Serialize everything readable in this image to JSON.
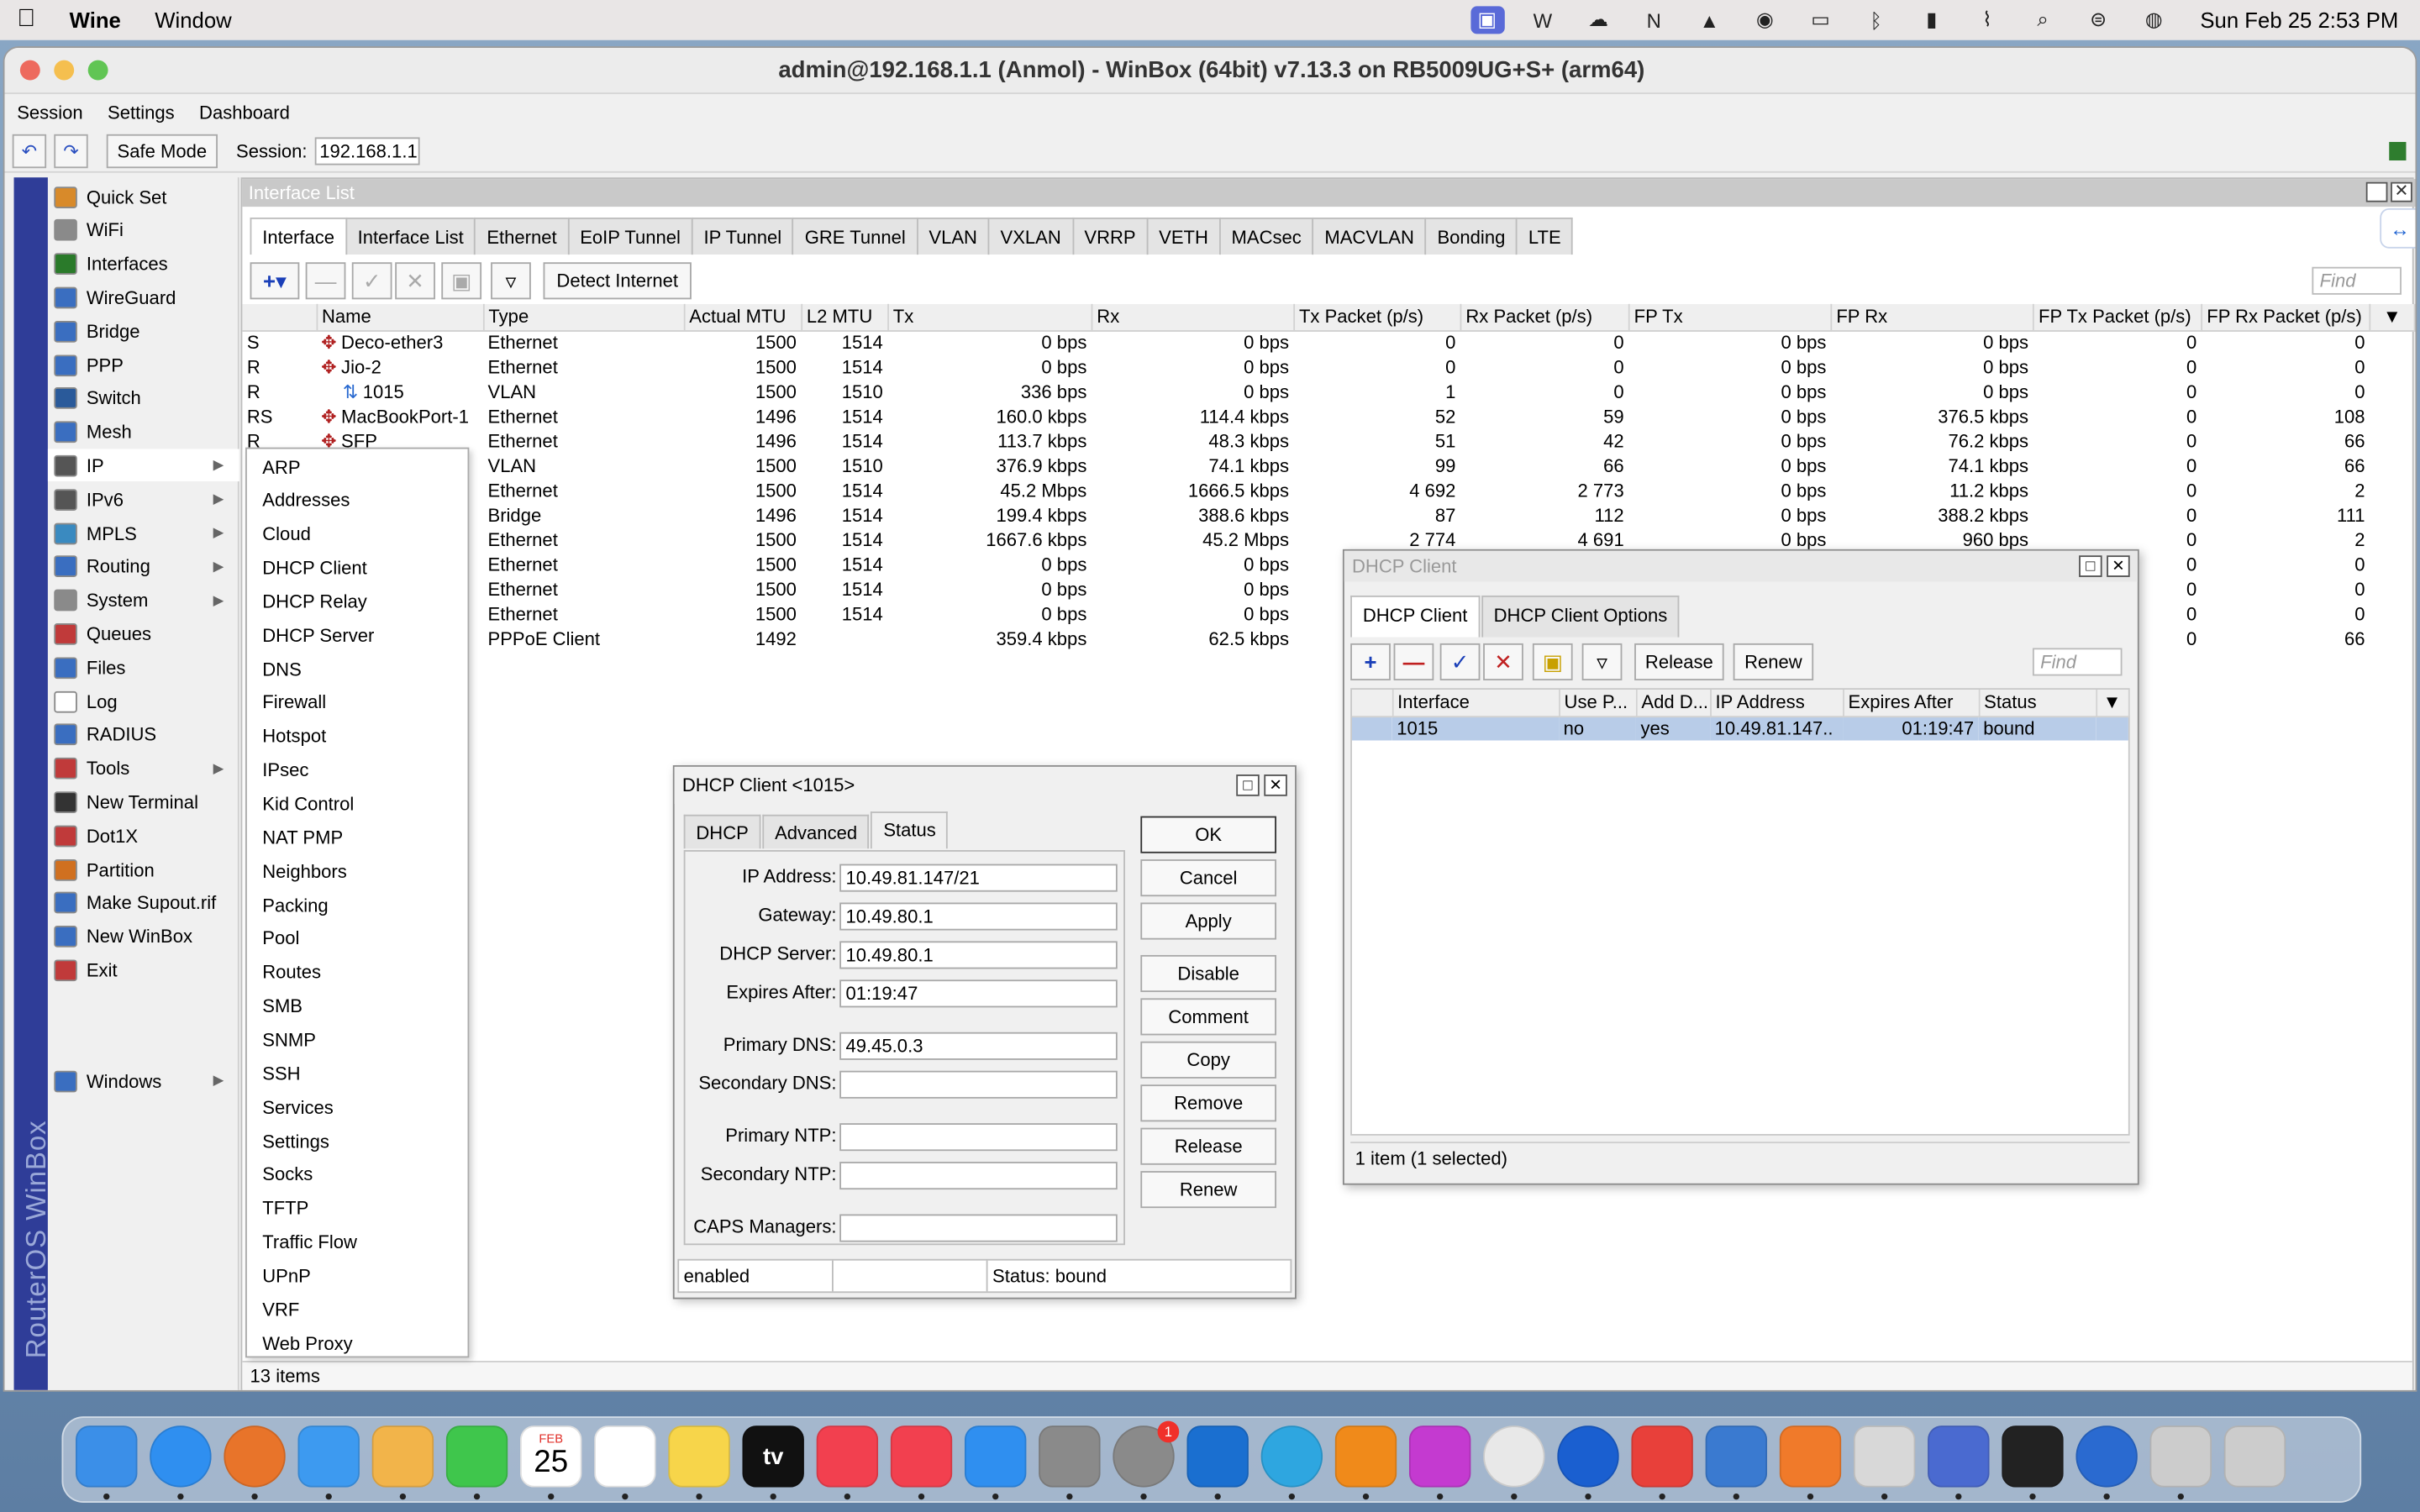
{
  "menubar": {
    "app_name": "Wine",
    "items": [
      "Window"
    ],
    "datetime": "Sun Feb 25  2:53 PM",
    "icons": [
      "screen-share-icon",
      "wps-icon",
      "cloud-icon",
      "n-icon",
      "vlc-icon",
      "notification-icon",
      "display-icon",
      "bluetooth-off-icon",
      "battery-icon",
      "wifi-off-icon",
      "search-icon",
      "control-center-icon",
      "siri-icon"
    ]
  },
  "window": {
    "title": "admin@192.168.1.1 (Anmol) - WinBox (64bit) v7.13.3 on RB5009UG+S+ (arm64)",
    "menu": [
      "Session",
      "Settings",
      "Dashboard"
    ],
    "safe_mode": "Safe Mode",
    "session_label": "Session:",
    "session_value": "192.168.1.1",
    "side_brand": "RouterOS WinBox"
  },
  "sidebar": [
    {
      "label": "Quick Set",
      "icon": "wand-icon",
      "color": "#d88a2a"
    },
    {
      "label": "WiFi",
      "icon": "wifi-icon",
      "color": "#8a8a8a"
    },
    {
      "label": "Interfaces",
      "icon": "interfaces-icon",
      "color": "#2a7a2a"
    },
    {
      "label": "WireGuard",
      "icon": "wireguard-icon",
      "color": "#3a6ec0"
    },
    {
      "label": "Bridge",
      "icon": "bridge-icon",
      "color": "#3a6ec0"
    },
    {
      "label": "PPP",
      "icon": "ppp-icon",
      "color": "#3a6ec0"
    },
    {
      "label": "Switch",
      "icon": "switch-icon",
      "color": "#2a5a9a"
    },
    {
      "label": "Mesh",
      "icon": "mesh-icon",
      "color": "#3a6ec0"
    },
    {
      "label": "IP",
      "icon": "ip-icon",
      "color": "#555555",
      "arrow": true
    },
    {
      "label": "IPv6",
      "icon": "ipv6-icon",
      "color": "#555555",
      "arrow": true
    },
    {
      "label": "MPLS",
      "icon": "mpls-icon",
      "color": "#3a8ac0",
      "arrow": true
    },
    {
      "label": "Routing",
      "icon": "routing-icon",
      "color": "#3a6ec0",
      "arrow": true
    },
    {
      "label": "System",
      "icon": "system-gear-icon",
      "color": "#8a8a8a",
      "arrow": true
    },
    {
      "label": "Queues",
      "icon": "queues-icon",
      "color": "#c03a3a"
    },
    {
      "label": "Files",
      "icon": "files-icon",
      "color": "#3a6ec0"
    },
    {
      "label": "Log",
      "icon": "log-icon",
      "color": "#ffffff"
    },
    {
      "label": "RADIUS",
      "icon": "radius-icon",
      "color": "#3a6ec0"
    },
    {
      "label": "Tools",
      "icon": "tools-icon",
      "color": "#c03a3a",
      "arrow": true
    },
    {
      "label": "New Terminal",
      "icon": "terminal-icon",
      "color": "#333333"
    },
    {
      "label": "Dot1X",
      "icon": "dot1x-icon",
      "color": "#c03a3a"
    },
    {
      "label": "Partition",
      "icon": "partition-icon",
      "color": "#d07020"
    },
    {
      "label": "Make Supout.rif",
      "icon": "supout-icon",
      "color": "#3a6ec0"
    },
    {
      "label": "New WinBox",
      "icon": "winbox-icon",
      "color": "#3a6ec0"
    },
    {
      "label": "Exit",
      "icon": "exit-icon",
      "color": "#c03a3a"
    },
    {
      "label": "Windows",
      "icon": "windows-icon",
      "color": "#3a6ec0",
      "arrow": true
    }
  ],
  "ip_submenu": [
    "ARP",
    "Addresses",
    "Cloud",
    "DHCP Client",
    "DHCP Relay",
    "DHCP Server",
    "DNS",
    "Firewall",
    "Hotspot",
    "IPsec",
    "Kid Control",
    "NAT PMP",
    "Neighbors",
    "Packing",
    "Pool",
    "Routes",
    "SMB",
    "SNMP",
    "SSH",
    "Services",
    "Settings",
    "Socks",
    "TFTP",
    "Traffic Flow",
    "UPnP",
    "VRF",
    "Web Proxy"
  ],
  "interface_list": {
    "title": "Interface List",
    "tabs": [
      "Interface",
      "Interface List",
      "Ethernet",
      "EoIP Tunnel",
      "IP Tunnel",
      "GRE Tunnel",
      "VLAN",
      "VXLAN",
      "VRRP",
      "VETH",
      "MACsec",
      "MACVLAN",
      "Bonding",
      "LTE"
    ],
    "detect_internet": "Detect Internet",
    "find_placeholder": "Find",
    "columns": [
      "",
      "Name",
      "Type",
      "Actual MTU",
      "L2 MTU",
      "Tx",
      "Rx",
      "Tx Packet (p/s)",
      "Rx Packet (p/s)",
      "FP Tx",
      "FP Rx",
      "FP Tx Packet (p/s)",
      "FP Rx Packet (p/s)"
    ],
    "rows": [
      [
        "S",
        "Deco-ether3",
        "Ethernet",
        "1500",
        "1514",
        "0 bps",
        "0 bps",
        "0",
        "0",
        "0 bps",
        "0 bps",
        "0",
        "0"
      ],
      [
        "R",
        "Jio-2",
        "Ethernet",
        "1500",
        "1514",
        "0 bps",
        "0 bps",
        "0",
        "0",
        "0 bps",
        "0 bps",
        "0",
        "0"
      ],
      [
        "R",
        "1015",
        "VLAN",
        "1500",
        "1510",
        "336 bps",
        "0 bps",
        "1",
        "0",
        "0 bps",
        "0 bps",
        "0",
        "0"
      ],
      [
        "RS",
        "MacBookPort-1",
        "Ethernet",
        "1496",
        "1514",
        "160.0 kbps",
        "114.4 kbps",
        "52",
        "59",
        "0 bps",
        "376.5 kbps",
        "0",
        "108"
      ],
      [
        "R",
        "SFP",
        "Ethernet",
        "1496",
        "1514",
        "113.7 kbps",
        "48.3 kbps",
        "51",
        "42",
        "0 bps",
        "76.2 kbps",
        "0",
        "66"
      ],
      [
        "",
        "",
        "VLAN",
        "1500",
        "1510",
        "376.9 kbps",
        "74.1 kbps",
        "99",
        "66",
        "0 bps",
        "74.1 kbps",
        "0",
        "66"
      ],
      [
        "",
        "",
        "Ethernet",
        "1500",
        "1514",
        "45.2 Mbps",
        "1666.5 kbps",
        "4 692",
        "2 773",
        "0 bps",
        "11.2 kbps",
        "0",
        "2"
      ],
      [
        "",
        "",
        "Bridge",
        "1496",
        "1514",
        "199.4 kbps",
        "388.6 kbps",
        "87",
        "112",
        "0 bps",
        "388.2 kbps",
        "0",
        "111"
      ],
      [
        "",
        "",
        "Ethernet",
        "1500",
        "1514",
        "1667.6 kbps",
        "45.2 Mbps",
        "2 774",
        "4 691",
        "0 bps",
        "960 bps",
        "0",
        "2"
      ],
      [
        "",
        "",
        "Ethernet",
        "1500",
        "1514",
        "0 bps",
        "0 bps",
        "",
        "",
        "",
        "",
        "0",
        "0"
      ],
      [
        "",
        "",
        "Ethernet",
        "1500",
        "1514",
        "0 bps",
        "0 bps",
        "",
        "",
        "",
        "",
        "0",
        "0"
      ],
      [
        "",
        "",
        "Ethernet",
        "1500",
        "1514",
        "0 bps",
        "0 bps",
        "",
        "",
        "",
        "",
        "0",
        "0"
      ],
      [
        "",
        "",
        "PPPoE Client",
        "1492",
        "",
        "359.4 kbps",
        "62.5 kbps",
        "",
        "",
        "",
        "",
        "0",
        "66"
      ]
    ],
    "footer": "13 items"
  },
  "dhcp_list": {
    "title": "DHCP Client",
    "tabs": [
      "DHCP Client",
      "DHCP Client Options"
    ],
    "release": "Release",
    "renew": "Renew",
    "find_placeholder": "Find",
    "columns": [
      "Interface",
      "Use P...",
      "Add D...",
      "IP Address",
      "Expires After",
      "Status"
    ],
    "rows": [
      [
        "1015",
        "no",
        "yes",
        "10.49.81.147..",
        "01:19:47",
        "bound"
      ]
    ],
    "footer": "1 item (1 selected)"
  },
  "dhcp_dialog": {
    "title": "DHCP Client <1015>",
    "tabs": [
      "DHCP",
      "Advanced",
      "Status"
    ],
    "fields": [
      {
        "label": "IP Address:",
        "value": "10.49.81.147/21"
      },
      {
        "label": "Gateway:",
        "value": "10.49.80.1"
      },
      {
        "label": "DHCP Server:",
        "value": "10.49.80.1"
      },
      {
        "label": "Expires After:",
        "value": "01:19:47"
      },
      {
        "label": "Primary DNS:",
        "value": "49.45.0.3"
      },
      {
        "label": "Secondary DNS:",
        "value": ""
      },
      {
        "label": "Primary NTP:",
        "value": ""
      },
      {
        "label": "Secondary NTP:",
        "value": ""
      },
      {
        "label": "CAPS Managers:",
        "value": ""
      }
    ],
    "buttons": [
      "OK",
      "Cancel",
      "Apply",
      "Disable",
      "Comment",
      "Copy",
      "Remove",
      "Release",
      "Renew"
    ],
    "status_left": "enabled",
    "status_right": "Status: bound"
  },
  "dock": {
    "calendar_month": "FEB",
    "calendar_day": "25",
    "tv_label": "tv",
    "badge": "1",
    "apps": [
      {
        "name": "finder-icon",
        "color": "#3b8fe8"
      },
      {
        "name": "safari-icon",
        "color": "#2f8ff0"
      },
      {
        "name": "firefox-icon",
        "color": "#e8742a"
      },
      {
        "name": "mail-icon",
        "color": "#3d9af0"
      },
      {
        "name": "photos-icon",
        "color": "#f2b44a"
      },
      {
        "name": "facetime-icon",
        "color": "#3fc64c"
      },
      {
        "name": "calendar-icon",
        "color": "#ffffff"
      },
      {
        "name": "reminders-icon",
        "color": "#ffffff"
      },
      {
        "name": "notes-icon",
        "color": "#f7d54a"
      },
      {
        "name": "apple-tv-icon",
        "color": "#111111"
      },
      {
        "name": "music-icon",
        "color": "#f2404f"
      },
      {
        "name": "news-icon",
        "color": "#f2404f"
      },
      {
        "name": "app-store-icon",
        "color": "#2f8ff0"
      },
      {
        "name": "screenshot-icon",
        "color": "#8a8a8a"
      },
      {
        "name": "system-settings-icon",
        "color": "#8a8a8a"
      },
      {
        "name": "outlook-icon",
        "color": "#1a6fd0"
      },
      {
        "name": "telegram-icon",
        "color": "#2ea6e0"
      },
      {
        "name": "vlc-dock-icon",
        "color": "#f08a1a"
      },
      {
        "name": "wps-dock-icon",
        "color": "#c43ad0"
      },
      {
        "name": "chrome-icon",
        "color": "#e8e8e8"
      },
      {
        "name": "teamviewer-icon",
        "color": "#1a5fd0"
      },
      {
        "name": "anydesk-icon",
        "color": "#e8403a"
      },
      {
        "name": "qbittorrent-icon",
        "color": "#3a7ad0"
      },
      {
        "name": "pen-app-icon",
        "color": "#f07a2a"
      },
      {
        "name": "wine-icon",
        "color": "#d8d8d8"
      },
      {
        "name": "preview-icon",
        "color": "#4a6ad0"
      },
      {
        "name": "terminal-dock-icon",
        "color": "#222222"
      },
      {
        "name": "winbox-dock-icon",
        "color": "#2a6ad0"
      },
      {
        "name": "downloads-stack-icon",
        "color": "#cccccc"
      },
      {
        "name": "trash-icon",
        "color": "#cccccc"
      }
    ]
  }
}
